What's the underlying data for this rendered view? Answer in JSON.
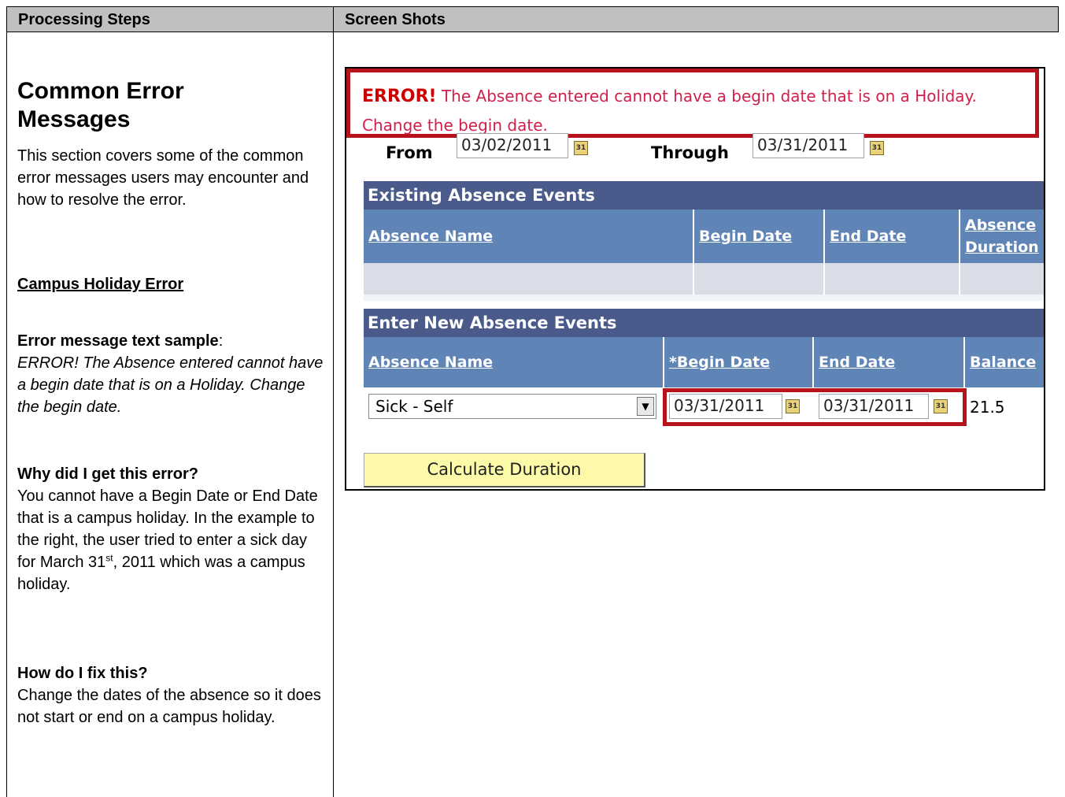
{
  "header": {
    "left": "Processing Steps",
    "right": "Screen Shots"
  },
  "left": {
    "title_line1": "Common Error",
    "title_line2": "Messages",
    "intro": "This section covers some of the common error messages users may encounter and how to resolve the error.",
    "subheading": "Campus Holiday Error",
    "sample_label": "Error message text sample",
    "sample_colon": ":",
    "sample_text": "ERROR! The Absence entered cannot have a begin date that is on a Holiday. Change the begin date.",
    "why_heading": "Why did I get this error?",
    "why_text_a": "You cannot have a Begin Date or End Date that is a campus holiday. In the example to the right, the user tried to enter a sick day for March 31",
    "why_sup": "st",
    "why_text_b": ", 2011 which was a campus holiday.",
    "fix_heading": "How do I fix this?",
    "fix_text": "Change the dates of the absence so it does not start or end on a campus holiday."
  },
  "screenshot": {
    "error_prefix": "ERROR!",
    "error_line1": " The Absence entered cannot have a begin date that is on a Holiday.",
    "error_line2": "Change the begin date.",
    "from_label": "From",
    "from_value": "03/02/2011",
    "through_label": "Through",
    "through_value": "03/31/2011",
    "calendar_icon_text": "31",
    "existing": {
      "title": "Existing Absence Events",
      "columns": [
        "Absence Name",
        "Begin Date",
        "End Date",
        "Absence",
        "Duration"
      ]
    },
    "new": {
      "title": "Enter New Absence Events",
      "columns": [
        "Absence Name",
        "*Begin Date",
        "End Date",
        "Balance"
      ],
      "row": {
        "absence_name": "Sick - Self",
        "begin_date": "03/31/2011",
        "end_date": "03/31/2011",
        "balance": "21.5"
      }
    },
    "button": "Calculate Duration"
  },
  "colors": {
    "header_bg": "#c0c0c0",
    "error_red": "#b8131d",
    "grid_title": "#4a5a8a",
    "grid_header": "#5f84b6",
    "button_bg": "#fcf9a8"
  }
}
